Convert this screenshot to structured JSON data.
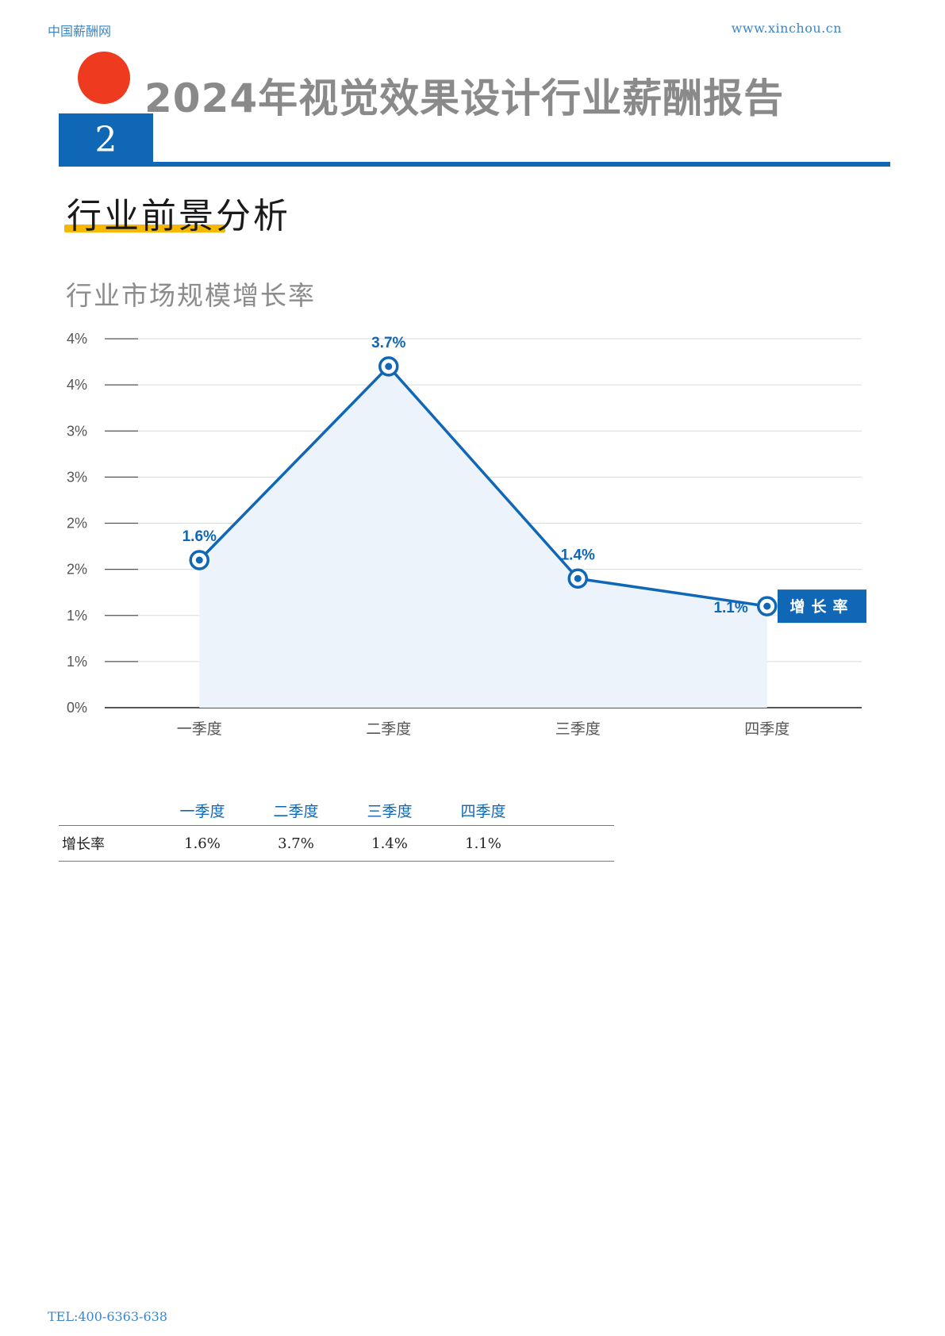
{
  "header": {
    "site_name": "中国薪酬网",
    "site_url": "www.xinchou.cn",
    "report_title": "2024年视觉效果设计行业薪酬报告",
    "chapter_number": "2"
  },
  "section": {
    "title": "行业前景分析",
    "chart_subtitle": "行业市场规模增长率"
  },
  "chart_data": {
    "type": "line",
    "categories": [
      "一季度",
      "二季度",
      "三季度",
      "四季度"
    ],
    "series": [
      {
        "name": "增长率",
        "values": [
          1.6,
          3.7,
          1.4,
          1.1
        ],
        "labels": [
          "1.6%",
          "3.7%",
          "1.4%",
          "1.1%"
        ]
      }
    ],
    "ylim": [
      0,
      4
    ],
    "yticks": [
      0,
      0.5,
      1,
      1.5,
      2,
      2.5,
      3,
      3.5,
      4
    ],
    "ytick_labels": [
      "0%",
      "1%",
      "1%",
      "2%",
      "2%",
      "3%",
      "3%",
      "4%",
      "4%"
    ],
    "grid": true,
    "area_fill": true,
    "legend_position": "right",
    "colors": {
      "line": "#0f67b6",
      "fill": "#edf3fa",
      "grid": "#d9d9d9",
      "axis": "#555555"
    }
  },
  "table": {
    "headers": [
      "",
      "一季度",
      "二季度",
      "三季度",
      "四季度",
      ""
    ],
    "rows": [
      {
        "label": "增长率",
        "cells": [
          "1.6%",
          "3.7%",
          "1.4%",
          "1.1%"
        ]
      }
    ]
  },
  "footer": {
    "tel": "TEL:400-6363-638"
  }
}
